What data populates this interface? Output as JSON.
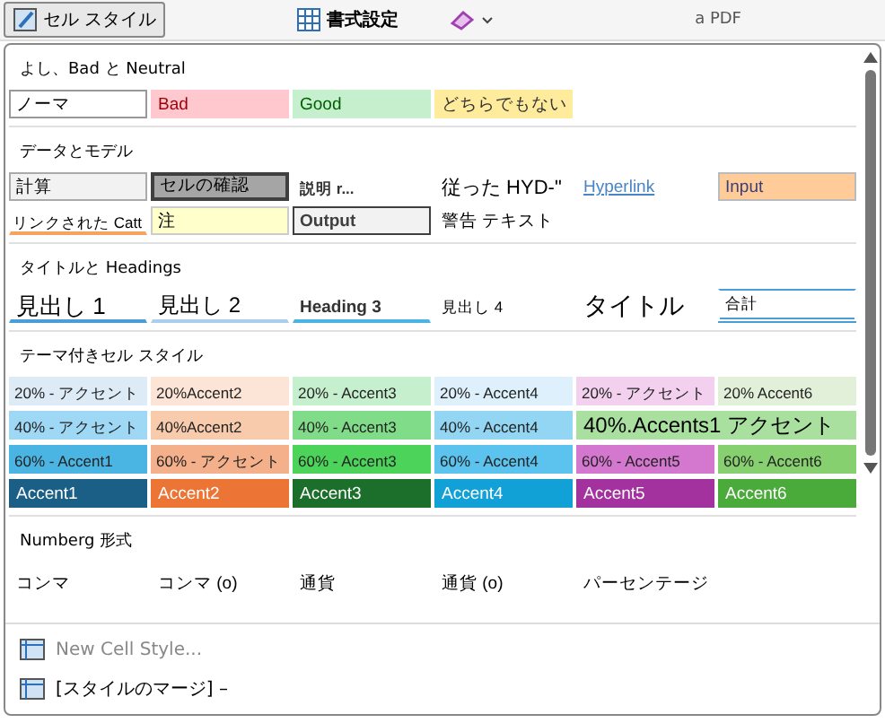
{
  "toolbar": [
    {
      "kind": "styles",
      "label": "セル スタイル",
      "selected": true
    },
    {
      "kind": "format",
      "label": "書式設定",
      "selected": false
    },
    {
      "kind": "eraser",
      "selected": false
    },
    {
      "kind": "text",
      "label": "a PDF",
      "selected": false
    }
  ],
  "sections": [
    {
      "title": "よし、Bad と Neutral",
      "items": [
        {
          "kind": "normal",
          "label": "ノーマ"
        },
        {
          "kind": "bad",
          "label": "Bad"
        },
        {
          "kind": "good",
          "label": "Good"
        },
        {
          "kind": "neutral",
          "label": "どちらでもない"
        }
      ]
    },
    {
      "title": "データとモデル",
      "items": [
        {
          "kind": "calc",
          "label": "計算"
        },
        {
          "kind": "check",
          "label": "セルの確認"
        },
        {
          "kind": "explanatory",
          "label": "説明 r..."
        },
        {
          "kind": "followed",
          "label": "従った HYD-\""
        },
        {
          "kind": "hyperlink",
          "label": "Hyperlink"
        },
        {
          "kind": "input",
          "label": "Input"
        },
        {
          "kind": "linked",
          "label": "リンクされた Catt"
        },
        {
          "kind": "note",
          "label": "注"
        },
        {
          "kind": "output",
          "label": "Output"
        },
        {
          "kind": "warning",
          "label": "警告 テキスト"
        }
      ]
    },
    {
      "title": "タイトルと Headings",
      "items": [
        {
          "kind": "h1",
          "label": "見出し 1"
        },
        {
          "kind": "h2",
          "label": "見出し 2"
        },
        {
          "kind": "h3",
          "label": "Heading 3"
        },
        {
          "kind": "h4",
          "label": "見出し 4"
        },
        {
          "kind": "title",
          "label": "タイトル"
        },
        {
          "kind": "total",
          "label": "合計"
        }
      ]
    },
    {
      "title": "テーマ付きセル スタイル",
      "items": [
        {
          "kind": "accent",
          "color": "#ddebf7",
          "label": "20% - アクセント"
        },
        {
          "kind": "accent",
          "color": "#fce4d6",
          "label": "20%Accent2"
        },
        {
          "kind": "accent",
          "color": "#c6efce",
          "label": "20% - Accent3"
        },
        {
          "kind": "accent",
          "color": "#ddf0fb",
          "label": "20% - Accent4"
        },
        {
          "kind": "accent",
          "color": "#f2d0ee",
          "label": "20% - アクセント"
        },
        {
          "kind": "accent",
          "color": "#e2f0d9",
          "label": "20% Accent6"
        },
        {
          "kind": "accent",
          "color": "#9ed8f5",
          "label": "40% - アクセント"
        },
        {
          "kind": "accent",
          "color": "#f8cbad",
          "label": "40%Accent2"
        },
        {
          "kind": "accent",
          "color": "#80dc88",
          "label": "40% - Accent3"
        },
        {
          "kind": "accent",
          "color": "#92d6f3",
          "label": "40% - Accent4"
        },
        {
          "kind": "wide",
          "color": "#a9e0a0",
          "label": "40%.Accents1 アクセント"
        },
        {
          "kind": "accent",
          "color": "#4ab5e3",
          "label": "60% - Accent1"
        },
        {
          "kind": "accent",
          "color": "#f4b08a",
          "label": "60% - アクセント"
        },
        {
          "kind": "accent",
          "color": "#4cd35a",
          "label": "60% - Accent3"
        },
        {
          "kind": "accent",
          "color": "#5bc3ee",
          "label": "60% - Accent4"
        },
        {
          "kind": "accent",
          "color": "#d477cf",
          "label": "60% - Accent5"
        },
        {
          "kind": "accent",
          "color": "#86d070",
          "label": "60% - Accent6"
        },
        {
          "kind": "dark",
          "color": "#1b5f86",
          "label": "Accent1"
        },
        {
          "kind": "dark",
          "color": "#ec7535",
          "label": "Accent2"
        },
        {
          "kind": "dark",
          "color": "#1c6f2b",
          "label": "Accent3"
        },
        {
          "kind": "dark",
          "color": "#12a1d6",
          "label": "Accent4"
        },
        {
          "kind": "dark",
          "color": "#a3329f",
          "label": "Accent5"
        },
        {
          "kind": "dark",
          "color": "#4aaa3a",
          "label": "Accent6"
        }
      ]
    },
    {
      "title": "Numberg 形式",
      "items": [
        {
          "kind": "plain",
          "label": "コンマ"
        },
        {
          "kind": "plain",
          "label": "コンマ (o)"
        },
        {
          "kind": "plain",
          "label": "通貨"
        },
        {
          "kind": "plain",
          "label": "通貨 (o)"
        },
        {
          "kind": "plain",
          "label": "パーセンテージ"
        }
      ]
    }
  ],
  "menu": [
    {
      "label": "New Cell Style...",
      "disabled": true
    },
    {
      "label": "[スタイルのマージ] –",
      "disabled": false
    }
  ]
}
